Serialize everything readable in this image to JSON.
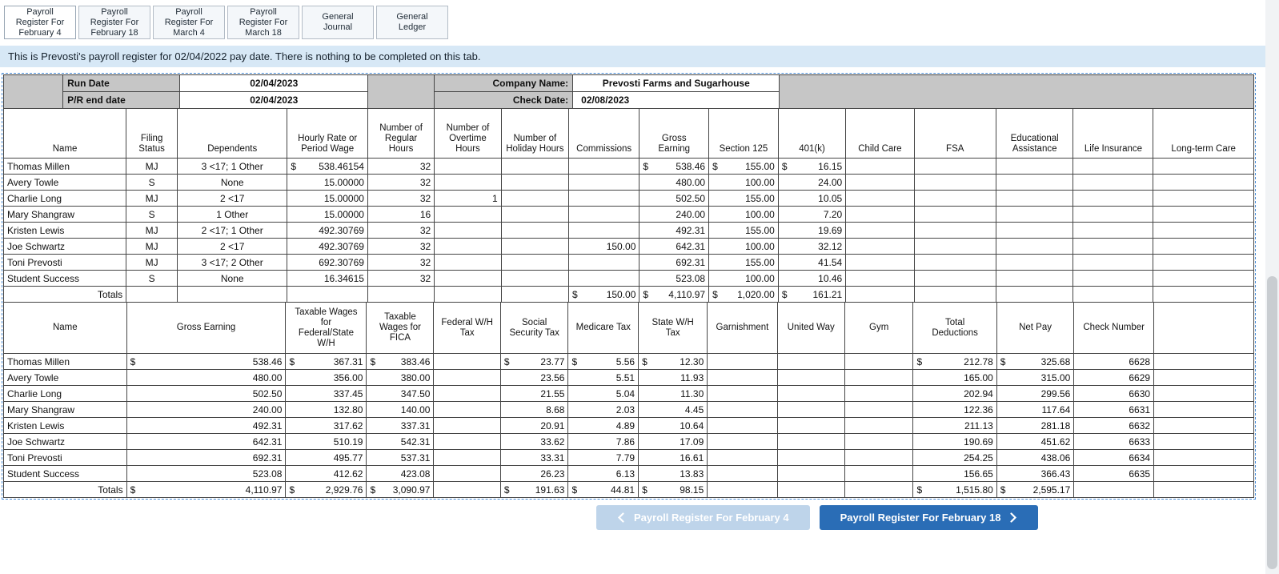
{
  "colors": {
    "accent_blue": "#2a6db6",
    "disabled_button_blue": "#bed4ea",
    "banner_background": "#d7e8f6",
    "header_gray": "#c6c6c6",
    "selection_dash_blue": "#4d8ed6"
  },
  "tabs": [
    {
      "label": "Payroll Register For February 4",
      "active": true
    },
    {
      "label": "Payroll Register For February 18",
      "active": false
    },
    {
      "label": "Payroll Register For March 4",
      "active": false
    },
    {
      "label": "Payroll Register For March 18",
      "active": false
    },
    {
      "label": "General Journal",
      "active": false
    },
    {
      "label": "General Ledger",
      "active": false
    }
  ],
  "banner": {
    "text": "This is Prevosti's payroll register for 02/04/2022 pay date. There is nothing to be completed on this tab."
  },
  "meta": {
    "run_date_label": "Run Date",
    "run_date": "02/04/2023",
    "pr_end_label": "P/R end date",
    "pr_end_date": "02/04/2023",
    "company_label": "Company Name:",
    "company_name": "Prevosti Farms and Sugarhouse",
    "check_date_label": "Check Date:",
    "check_date": "02/08/2023"
  },
  "earnings_table": {
    "headers": [
      "Name",
      "Filing\nStatus",
      "Dependents",
      "Hourly Rate or\nPeriod Wage",
      "Number of\nRegular\nHours",
      "Number of\nOvertime\nHours",
      "Number of\nHoliday Hours",
      "Commissions",
      "Gross\nEarning",
      "Section 125",
      "401(k)",
      "Child Care",
      "FSA",
      "Educational\nAssistance",
      "Life Insurance",
      "Long-term Care"
    ],
    "rows": [
      [
        "Thomas Millen",
        "MJ",
        "3 <17; 1 Other",
        [
          "$",
          "538.46154"
        ],
        "32",
        "",
        "",
        "",
        [
          "$",
          "538.46"
        ],
        [
          "$",
          "155.00"
        ],
        [
          "$",
          "16.15"
        ],
        "",
        "",
        "",
        "",
        ""
      ],
      [
        "Avery Towle",
        "S",
        "None",
        "15.00000",
        "32",
        "",
        "",
        "",
        "480.00",
        "100.00",
        "24.00",
        "",
        "",
        "",
        "",
        ""
      ],
      [
        "Charlie Long",
        "MJ",
        "2 <17",
        "15.00000",
        "32",
        "1",
        "",
        "",
        "502.50",
        "155.00",
        "10.05",
        "",
        "",
        "",
        "",
        ""
      ],
      [
        "Mary Shangraw",
        "S",
        "1 Other",
        "15.00000",
        "16",
        "",
        "",
        "",
        "240.00",
        "100.00",
        "7.20",
        "",
        "",
        "",
        "",
        ""
      ],
      [
        "Kristen Lewis",
        "MJ",
        "2 <17; 1 Other",
        "492.30769",
        "32",
        "",
        "",
        "",
        "492.31",
        "155.00",
        "19.69",
        "",
        "",
        "",
        "",
        ""
      ],
      [
        "Joe Schwartz",
        "MJ",
        "2 <17",
        "492.30769",
        "32",
        "",
        "",
        "150.00",
        "642.31",
        "100.00",
        "32.12",
        "",
        "",
        "",
        "",
        ""
      ],
      [
        "Toni Prevosti",
        "MJ",
        "3 <17; 2 Other",
        "692.30769",
        "32",
        "",
        "",
        "",
        "692.31",
        "155.00",
        "41.54",
        "",
        "",
        "",
        "",
        ""
      ],
      [
        "Student Success",
        "S",
        "None",
        "16.34615",
        "32",
        "",
        "",
        "",
        "523.08",
        "100.00",
        "10.46",
        "",
        "",
        "",
        "",
        ""
      ]
    ],
    "totals": [
      "Totals",
      "",
      "",
      "",
      "",
      "",
      "",
      [
        "$",
        "150.00"
      ],
      [
        "$",
        "4,110.97"
      ],
      [
        "$",
        "1,020.00"
      ],
      [
        "$",
        "161.21"
      ],
      "",
      "",
      "",
      "",
      ""
    ]
  },
  "deductions_table": {
    "headers": [
      "Name",
      "Gross Earning",
      "Taxable Wages\nfor\nFederal/State\nW/H",
      "Taxable\nWages for\nFICA",
      "Federal W/H\nTax",
      "Social\nSecurity Tax",
      "Medicare Tax",
      "State W/H\nTax",
      "Garnishment",
      "United Way",
      "Gym",
      "Total\nDeductions",
      "Net Pay",
      "Check Number",
      ""
    ],
    "rows": [
      [
        "Thomas Millen",
        [
          "$",
          "538.46"
        ],
        [
          "$",
          "367.31"
        ],
        [
          "$",
          "383.46"
        ],
        "",
        [
          "$",
          "23.77"
        ],
        [
          "$",
          "5.56"
        ],
        [
          "$",
          "12.30"
        ],
        "",
        "",
        "",
        [
          "$",
          "212.78"
        ],
        [
          "$",
          "325.68"
        ],
        "6628",
        ""
      ],
      [
        "Avery Towle",
        "480.00",
        "356.00",
        "380.00",
        "",
        "23.56",
        "5.51",
        "11.93",
        "",
        "",
        "",
        "165.00",
        "315.00",
        "6629",
        ""
      ],
      [
        "Charlie Long",
        "502.50",
        "337.45",
        "347.50",
        "",
        "21.55",
        "5.04",
        "11.30",
        "",
        "",
        "",
        "202.94",
        "299.56",
        "6630",
        ""
      ],
      [
        "Mary Shangraw",
        "240.00",
        "132.80",
        "140.00",
        "",
        "8.68",
        "2.03",
        "4.45",
        "",
        "",
        "",
        "122.36",
        "117.64",
        "6631",
        ""
      ],
      [
        "Kristen Lewis",
        "492.31",
        "317.62",
        "337.31",
        "",
        "20.91",
        "4.89",
        "10.64",
        "",
        "",
        "",
        "211.13",
        "281.18",
        "6632",
        ""
      ],
      [
        "Joe Schwartz",
        "642.31",
        "510.19",
        "542.31",
        "",
        "33.62",
        "7.86",
        "17.09",
        "",
        "",
        "",
        "190.69",
        "451.62",
        "6633",
        ""
      ],
      [
        "Toni Prevosti",
        "692.31",
        "495.77",
        "537.31",
        "",
        "33.31",
        "7.79",
        "16.61",
        "",
        "",
        "",
        "254.25",
        "438.06",
        "6634",
        ""
      ],
      [
        "Student Success",
        "523.08",
        "412.62",
        "423.08",
        "",
        "26.23",
        "6.13",
        "13.83",
        "",
        "",
        "",
        "156.65",
        "366.43",
        "6635",
        ""
      ]
    ],
    "totals": [
      "Totals",
      [
        "$",
        "4,110.97"
      ],
      [
        "$",
        "2,929.76"
      ],
      [
        "$",
        "3,090.97"
      ],
      "",
      [
        "$",
        "191.63"
      ],
      [
        "$",
        "44.81"
      ],
      [
        "$",
        "98.15"
      ],
      "",
      "",
      "",
      [
        "$",
        "1,515.80"
      ],
      [
        "$",
        "2,595.17"
      ],
      "",
      ""
    ]
  },
  "nav": {
    "prev_label": "Payroll Register For February 4",
    "next_label": "Payroll Register For February 18"
  },
  "icons": {
    "prev": "chevron-left",
    "next": "chevron-right"
  }
}
